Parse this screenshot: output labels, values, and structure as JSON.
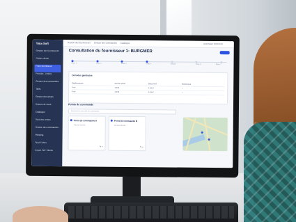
{
  "app": {
    "logo": "Yaka Soft",
    "page_title": "Consultation du fournisseur 1: BURGMER",
    "topbar": {
      "items": [
        "Gestion des fournisseurs",
        "Gestion des commandes",
        "Catalogue"
      ],
      "user": "Jean-Marc DURAND"
    },
    "sidebar": {
      "items": [
        "Gestion des fournisseurs",
        "Fichier clients",
        "Fiche fournisseur",
        "Produits - Articles",
        "Gestion des commandes",
        "Tarifs",
        "Gestion des achats",
        "Retours de stock",
        "Catalogue",
        "Suivi des ventes",
        "Gestion des commandes",
        "Planning",
        "Suivi Fiches",
        "Export PDF Clients"
      ],
      "active_index": 2
    },
    "stepper": {
      "steps": [
        "Étape 1",
        "Étape 2",
        "Étape 3",
        "Étape 4",
        "Étape 5",
        "Étape 6",
        "Étape 7"
      ],
      "current_index": 3
    },
    "general_card": {
      "title": "Données générales",
      "columns": [
        "Établissement",
        "Dernier achat",
        "Statut tarif",
        "Remboursé"
      ],
      "rows": [
        [
          "Tiroir",
          "1/8/18",
          "4 500 €",
          "✓"
        ],
        [
          "Tiroir",
          "1/8/18",
          "4 500 €",
          "✓"
        ]
      ]
    },
    "orders": {
      "title": "Points de commande",
      "search_placeholder": "Rechercher un point de commande",
      "cards": [
        {
          "title": "Point de commande A",
          "sub": "Aucune donnée"
        },
        {
          "title": "Point de commande B",
          "sub": "Aucune donnée"
        }
      ]
    }
  },
  "colors": {
    "sidebar": "#263352",
    "accent": "#2f55e0"
  }
}
